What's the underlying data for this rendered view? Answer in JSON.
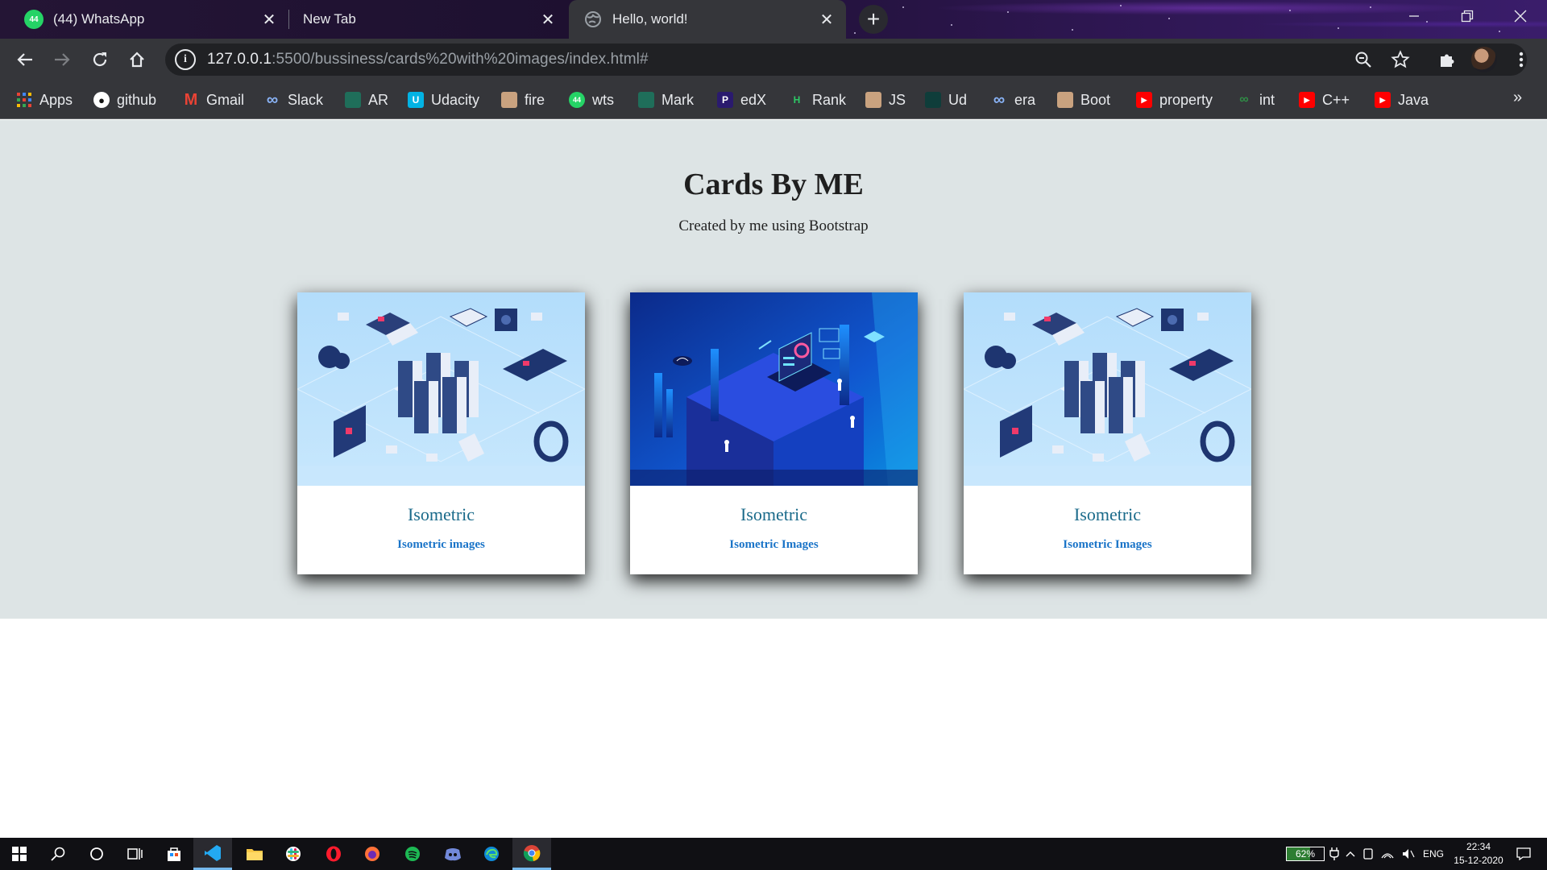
{
  "browser": {
    "tabs": [
      {
        "title": "(44) WhatsApp",
        "badge": "44",
        "icon": "whatsapp-icon"
      },
      {
        "title": "New Tab",
        "icon": "none"
      },
      {
        "title": "Hello, world!",
        "icon": "globe-icon",
        "active": true
      }
    ],
    "close_glyph": "✕",
    "new_tab_glyph": "+",
    "url_host": "127.0.0.1",
    "url_rest": ":5500/bussiness/cards%20with%20images/index.html#",
    "bookmarks": [
      {
        "label": "Apps",
        "icon": "apps-grid-icon"
      },
      {
        "label": "github",
        "icon": "github-icon"
      },
      {
        "label": "Gmail",
        "icon": "gmail-icon"
      },
      {
        "label": "Slack",
        "icon": "infinity-icon"
      },
      {
        "label": "AR",
        "icon": "leaf-icon"
      },
      {
        "label": "Udacity",
        "icon": "udacity-icon"
      },
      {
        "label": "fire",
        "icon": "person-avatar-icon"
      },
      {
        "label": "wts",
        "icon": "whatsapp-icon",
        "badge": "44"
      },
      {
        "label": "Mark",
        "icon": "leaf-icon"
      },
      {
        "label": "edX",
        "icon": "p-icon",
        "glyph": "P"
      },
      {
        "label": "Rank",
        "icon": "hackerrank-icon",
        "glyph": "H"
      },
      {
        "label": "JS",
        "icon": "person-avatar-icon"
      },
      {
        "label": "Ud",
        "icon": "leaf-dark-icon"
      },
      {
        "label": "era",
        "icon": "infinity-icon"
      },
      {
        "label": "Boot",
        "icon": "person-avatar-icon"
      },
      {
        "label": "property",
        "icon": "youtube-icon"
      },
      {
        "label": "int",
        "icon": "geeksforgeeks-icon"
      },
      {
        "label": "C++",
        "icon": "youtube-icon"
      },
      {
        "label": "Java",
        "icon": "youtube-icon"
      }
    ],
    "more_glyph": "»"
  },
  "page": {
    "title": "Cards By ME",
    "subtitle": "Created by me using Bootstrap",
    "cards": [
      {
        "title": "Isometric",
        "link": "Isometric images",
        "image": "light"
      },
      {
        "title": "Isometric",
        "link": "Isometric Images",
        "image": "dark"
      },
      {
        "title": "Isometric",
        "link": "Isometric Images",
        "image": "light"
      }
    ]
  },
  "taskbar": {
    "battery": "62%",
    "battery_level": 0.62,
    "lang": "ENG",
    "time": "22:34",
    "date": "15-12-2020"
  },
  "colors": {
    "page_bg": "#dde4e5",
    "card_title": "#1a6a8a",
    "card_link": "#1a74c8"
  }
}
